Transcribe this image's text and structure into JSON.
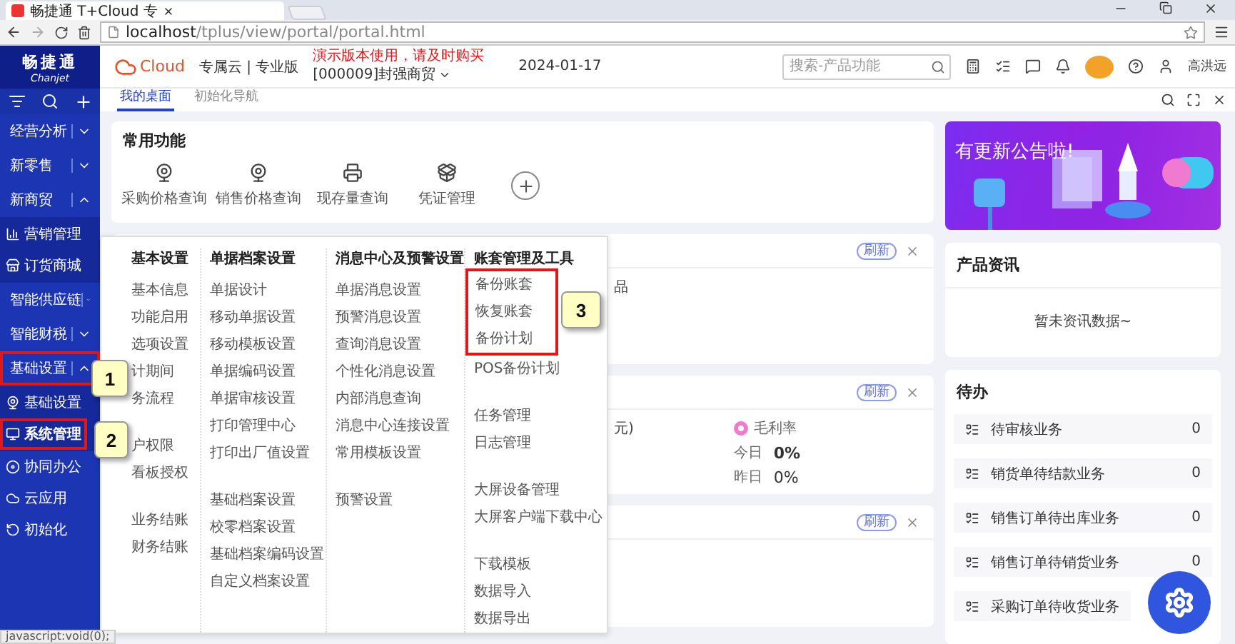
{
  "browser": {
    "tab_title": "畅捷通 T+Cloud 专",
    "url": "**localhost**/tplus/view/portal/portal.html",
    "status_text": "javascript:void(0);"
  },
  "sidebar": {
    "logo": "畅捷通",
    "logo_sub": "Chanjet",
    "items": [
      {
        "label": "经营分析",
        "expanded": false,
        "outlined": false
      },
      {
        "label": "新零售",
        "expanded": false,
        "outlined": false
      },
      {
        "label": "新商贸",
        "expanded": true,
        "outlined": false,
        "children": [
          {
            "label": "营销管理",
            "selected": false,
            "outlined": false
          },
          {
            "label": "订货商城",
            "selected": false,
            "outlined": false
          }
        ]
      },
      {
        "label": "智能供应链",
        "expanded": false,
        "outlined": false
      },
      {
        "label": "智能财税",
        "expanded": false,
        "outlined": false
      },
      {
        "label": "基础设置",
        "expanded": true,
        "outlined": true,
        "children": [
          {
            "label": "基础设置",
            "selected": false,
            "outlined": false
          },
          {
            "label": "系统管理",
            "selected": true,
            "outlined": true
          }
        ]
      },
      {
        "label": "协同办公",
        "kind": "leaf"
      },
      {
        "label": "云应用",
        "kind": "leaf"
      },
      {
        "label": "初始化",
        "kind": "leaf"
      }
    ]
  },
  "header": {
    "brand": "Cloud",
    "edition": "专属云 | 专业版",
    "notice": "演示版本使用，请及时购买",
    "company": "[000009]封强商贸",
    "date": "2024-01-17",
    "search": {
      "placeholder": "搜索-产品功能"
    },
    "user": "高洪远"
  },
  "tabs": [
    {
      "label": "我的桌面",
      "selected": true
    },
    {
      "label": "初始化导航",
      "selected": false
    }
  ],
  "shortcuts": {
    "title": "常用功能",
    "items": [
      "采购价格查询",
      "销售价格查询",
      "现存量查询",
      "凭证管理"
    ]
  },
  "cards": [
    {
      "kind": "list",
      "refresh": "刷新",
      "text": "品"
    },
    {
      "kind": "stats",
      "refresh": "刷新",
      "text": "元)",
      "stat": {
        "label": "毛利率",
        "rows": [
          {
            "label": "今日",
            "value": "0%",
            "bold": true
          },
          {
            "label": "昨日",
            "value": "0%",
            "bold": false
          }
        ]
      }
    },
    {
      "kind": "empty",
      "refresh": "刷新"
    }
  ],
  "banner": {
    "title": "有更新公告啦!"
  },
  "news": {
    "title": "产品资讯",
    "empty": "暂未资讯数据~"
  },
  "todo": {
    "title": "待办",
    "items": [
      {
        "label": "待审核业务",
        "count": "0"
      },
      {
        "label": "销货单待结款业务",
        "count": "0"
      },
      {
        "label": "销售订单待出库业务",
        "count": "0"
      },
      {
        "label": "销售订单待销货业务",
        "count": "0"
      },
      {
        "label": "采购订单待收货业务"
      }
    ]
  },
  "menu": {
    "columns": [
      {
        "title": "基本设置",
        "groups": [
          {
            "outlined": false,
            "items": [
              "基本信息",
              "功能启用",
              "选项设置",
              "计期间",
              "务流程"
            ]
          },
          {
            "outlined": false,
            "items": [
              "户权限",
              "看板授权"
            ]
          },
          {
            "outlined": false,
            "items": [
              "业务结账",
              "财务结账"
            ]
          }
        ]
      },
      {
        "title": "单据档案设置",
        "groups": [
          {
            "outlined": false,
            "items": [
              "单据设计",
              "移动单据设置",
              "移动模板设置",
              "单据编码设置",
              "单据审核设置",
              "打印管理中心",
              "打印出厂值设置"
            ]
          },
          {
            "outlined": false,
            "items": [
              "基础档案设置",
              "校零档案设置",
              "基础档案编码设置",
              "自定义档案设置"
            ]
          }
        ]
      },
      {
        "title": "消息中心及预警设置",
        "groups": [
          {
            "outlined": false,
            "items": [
              "单据消息设置",
              "预警消息设置",
              "查询消息设置",
              "个性化消息设置",
              "内部消息查询",
              "消息中心连接设置",
              "常用模板设置"
            ]
          },
          {
            "outlined": false,
            "items": [
              "预警设置"
            ]
          }
        ]
      },
      {
        "title": "账套管理及工具",
        "groups": [
          {
            "outlined": true,
            "items": [
              "备份账套",
              "恢复账套",
              "备份计划"
            ]
          },
          {
            "outlined": false,
            "items": [
              "POS备份计划"
            ]
          },
          {
            "outlined": false,
            "items": [
              "任务管理",
              "日志管理"
            ]
          },
          {
            "outlined": false,
            "items": [
              "大屏设备管理",
              "大屏客户端下载中心"
            ]
          },
          {
            "outlined": false,
            "items": [
              "下载模板",
              "数据导入",
              "数据导出"
            ]
          }
        ]
      }
    ]
  },
  "callouts": [
    {
      "label": "1"
    },
    {
      "label": "2"
    },
    {
      "label": "3"
    }
  ]
}
